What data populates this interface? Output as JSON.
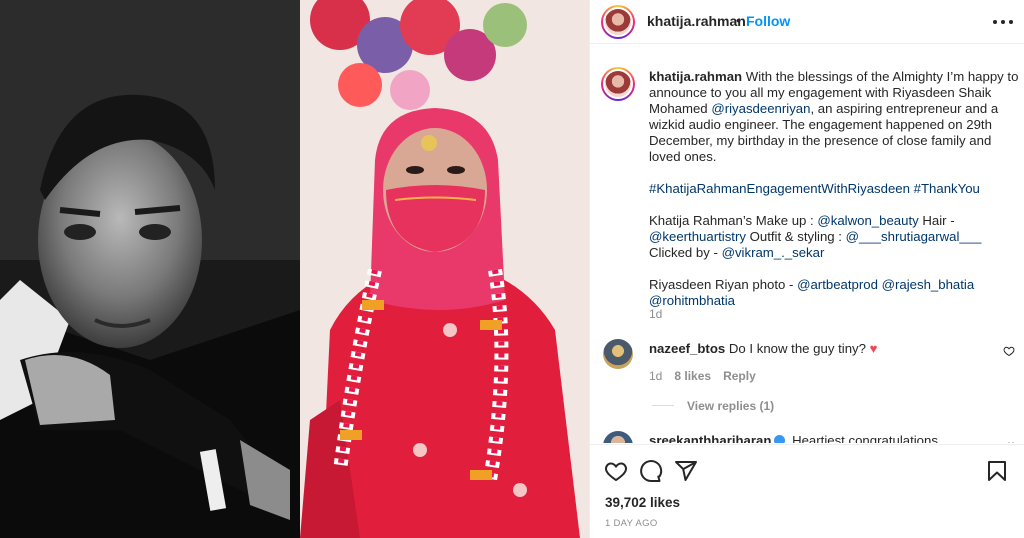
{
  "post": {
    "username": "khatija.rahman",
    "follow_label": "Follow",
    "separator": "•",
    "caption_parts": {
      "text_1": " With the blessings of the Almighty I’m happy to announce to you all my engagement with Riyasdeen Shaik Mohamed ",
      "mention_1": "@riyasdeenriyan",
      "text_2": ", an aspiring entrepreneur and a wizkid audio engineer. The engagement happened on 29th December, my birthday in the presence of close family and loved ones.",
      "hashtag_1": "#KhatijaRahmanEngagementWithRiyasdeen",
      "hashtag_2": "#ThankYou",
      "credits_1": "Khatija Rahman’s Make up : ",
      "mention_makeup": "@kalwon_beauty",
      "credits_2": " Hair - ",
      "mention_hair": "@keerthuartistry",
      "credits_3": " Outfit & styling : ",
      "mention_styling": "@___shrutiagarwal___",
      "credits_4": " Clicked by - ",
      "mention_clicked": "@vikram_._sekar",
      "photo_credit_1": "Riyasdeen Riyan photo - ",
      "mention_artbeat": "@artbeatprod",
      "mention_rajesh": "@rajesh_bhatia",
      "mention_rohit": "@rohitmbhatia"
    },
    "caption_time": "1d",
    "comments": [
      {
        "username": "nazeef_btos",
        "text": " Do I know the guy tiny? ",
        "emoji": "♥",
        "time": "1d",
        "likes": "8 likes",
        "reply_label": "Reply",
        "view_replies": "View replies (1)"
      },
      {
        "username": "sreekanthhariharan",
        "text": " Heartiest congratulations",
        "more": "··"
      }
    ],
    "likes_count": "39,702 likes",
    "date": "1 DAY AGO"
  },
  "colors": {
    "link": "#00376b",
    "follow": "#0095f6",
    "secondary_text": "#8e8e8e",
    "heart": "#ed4956"
  },
  "icons": [
    "more-options-icon",
    "heart-icon",
    "comment-icon",
    "share-icon",
    "bookmark-icon",
    "small-heart-icon",
    "verified-badge-icon"
  ]
}
